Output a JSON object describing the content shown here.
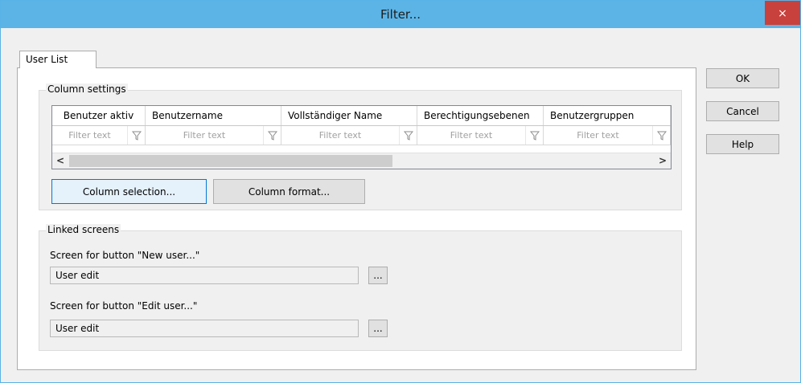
{
  "window": {
    "title": "Filter...",
    "close_glyph": "×",
    "titlebar_color": "#5cb4e6",
    "close_color": "#c8413c"
  },
  "tabs": [
    {
      "label": "User List"
    }
  ],
  "column_settings": {
    "legend": "Column settings",
    "columns": [
      {
        "header": "Benutzer aktiv",
        "filter_placeholder": "Filter text"
      },
      {
        "header": "Benutzername",
        "filter_placeholder": "Filter text"
      },
      {
        "header": "Vollständiger Name",
        "filter_placeholder": "Filter text"
      },
      {
        "header": "Berechtigungsebenen",
        "filter_placeholder": "Filter text"
      },
      {
        "header": "Benutzergruppen",
        "filter_placeholder": "Filter text"
      }
    ],
    "scroll_left": "<",
    "scroll_right": ">",
    "column_selection_button": "Column selection...",
    "column_format_button": "Column format..."
  },
  "linked_screens": {
    "legend": "Linked screens",
    "new_user": {
      "label": "Screen for button \"New user...\"",
      "value": "User edit",
      "browse": "..."
    },
    "edit_user": {
      "label": "Screen for button \"Edit user...\"",
      "value": "User edit",
      "browse": "..."
    }
  },
  "actions": {
    "ok": "OK",
    "cancel": "Cancel",
    "help": "Help"
  },
  "icons": {
    "filter": "funnel-icon"
  }
}
